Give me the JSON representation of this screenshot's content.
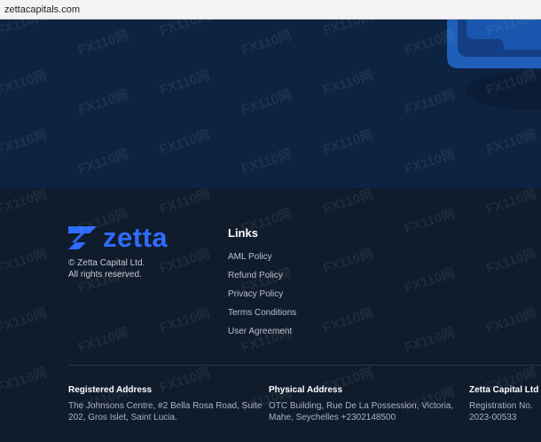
{
  "browser": {
    "url": "zettacapitals.com"
  },
  "brand": {
    "name": "zetta",
    "color": "#2f6bff"
  },
  "footer": {
    "copyright_line1": "© Zetta Capital Ltd.",
    "copyright_line2": "All rights reserved.",
    "links_title": "Links",
    "links": [
      {
        "label": "AML Policy"
      },
      {
        "label": "Refund Policy"
      },
      {
        "label": "Privacy Policy"
      },
      {
        "label": "Terms Conditions"
      },
      {
        "label": "User Agreement"
      }
    ],
    "registered": {
      "title": "Registered Address",
      "line1": "The Johnsons Centre, #2 Bella Rosa Road, Suite",
      "line2": "202, Gros Islet, Saint Lucia."
    },
    "physical": {
      "title": "Physical Address",
      "line1": "OTC Building, Rue De La Possession, Victoria,",
      "line2": "Mahe, Seychelles +2302148500"
    },
    "company": {
      "title": "Zetta Capital Ltd",
      "line1": "Registration No.",
      "line2": "2023-00533"
    }
  },
  "watermark": {
    "text": "FX110网"
  }
}
